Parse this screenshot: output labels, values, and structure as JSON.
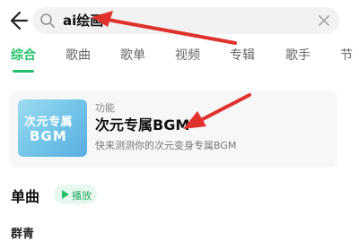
{
  "search": {
    "query": "ai绘画"
  },
  "tabs": [
    {
      "label": "综合"
    },
    {
      "label": "歌曲"
    },
    {
      "label": "歌单"
    },
    {
      "label": "视频"
    },
    {
      "label": "专辑"
    },
    {
      "label": "歌手"
    },
    {
      "label": "节"
    }
  ],
  "function_card": {
    "thumbnail_title": "次元专属",
    "thumbnail_sub": "BGM",
    "tag": "功能",
    "title": "次元专属BGM",
    "description": "快来测测你的次元变身专属BGM"
  },
  "songs_section": {
    "title": "单曲",
    "play_label": "播放",
    "first_song": "群青"
  },
  "colors": {
    "accent": "#23c06b",
    "annotation_arrow": "#e0322c"
  },
  "icons": {
    "back": "back-arrow-icon",
    "search": "search-icon",
    "clear": "close-icon",
    "play": "play-icon"
  }
}
